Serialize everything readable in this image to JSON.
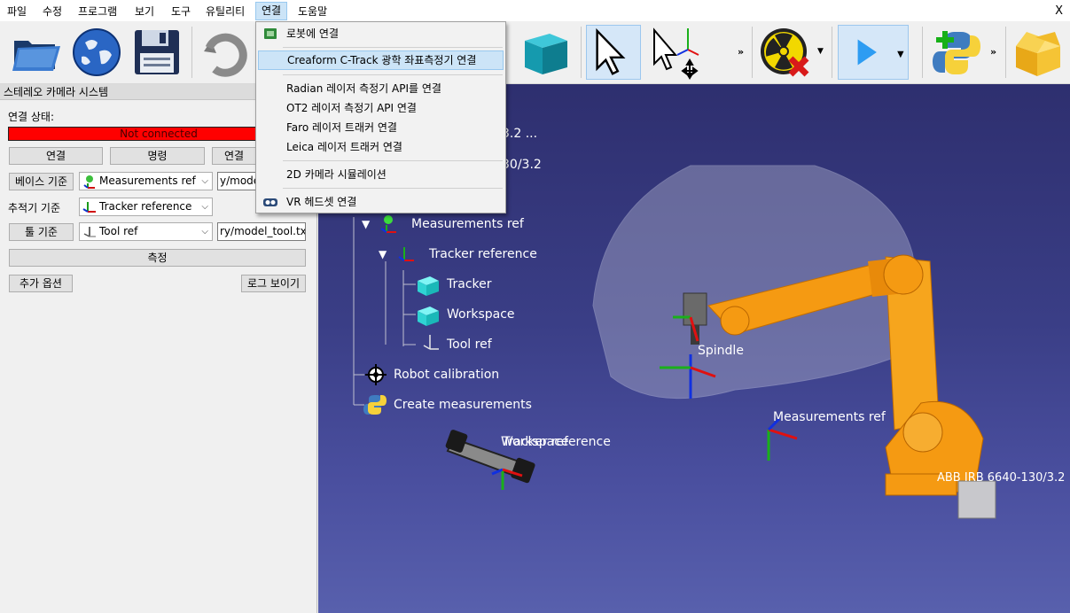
{
  "menubar": {
    "items": [
      "파일",
      "수정",
      "프로그램",
      "보기",
      "도구",
      "유틸리티",
      "연결",
      "도움말"
    ],
    "close": "X"
  },
  "toolbar": {
    "icons": [
      "open-folder-icon",
      "globe-icon",
      "save-disk-icon",
      "undo-icon",
      "cube-icon",
      "select-arrow-icon",
      "move-frame-icon",
      "radiation-stop-icon",
      "play-icon",
      "python-add-icon",
      "package-box-icon"
    ],
    "more": "»"
  },
  "dropdown": {
    "items": [
      {
        "label": "로봇에 연결",
        "icon": "robot-connect-icon"
      },
      {
        "label": "Creaform C-Track 광학 좌표측정기 연결",
        "highlighted": true
      },
      {
        "label": "Radian 레이저 측정기 API를 연결"
      },
      {
        "label": "OT2 레이저 측정기 API 연결"
      },
      {
        "label": "Faro 레이저 트래커 연결"
      },
      {
        "label": "Leica 레이저 트래커 연결"
      },
      {
        "label": "2D 카메라 시뮬레이션"
      },
      {
        "label": "VR 헤드셋 연결",
        "icon": "vr-headset-icon"
      }
    ]
  },
  "panel": {
    "title": "스테레오 카메라 시스템",
    "connection_label": "연결 상태:",
    "status": "Not connected",
    "status_color": "#ff0000",
    "buttons": {
      "connect": "연결",
      "command": "명령",
      "connect2": "연결",
      "measure": "측정",
      "more_options": "추가 옵션",
      "show_log": "로그 보이기"
    },
    "base": {
      "button": "베이스 기준",
      "combo": "Measurements ref",
      "field": "y/model"
    },
    "tracker": {
      "label": "추적기 기준",
      "combo": "Tracker reference"
    },
    "tool": {
      "button": "툴 기준",
      "combo": "Tool ref",
      "field": "ry/model_tool.txt"
    }
  },
  "viewport": {
    "tree": {
      "partial1": "3.2 ...",
      "partial2": "30/3.2",
      "items": [
        "Measurements ref",
        "Tracker reference",
        "Tracker",
        "Workspace",
        "Tool ref",
        "Robot calibration",
        "Create measurements"
      ]
    },
    "labels": {
      "spindle": "Spindle",
      "measurements_ref": "Measurements ref",
      "workspace_overlap_a": "Workspace",
      "workspace_overlap_b": "Tracker reference",
      "robot": "ABB IRB 6640-130/3.2"
    }
  },
  "colors": {
    "viewport_top": "#2e2f6f",
    "viewport_bottom": "#5860ad",
    "robot_orange": "#f59a12",
    "menu_highlight": "#cce4f7"
  }
}
